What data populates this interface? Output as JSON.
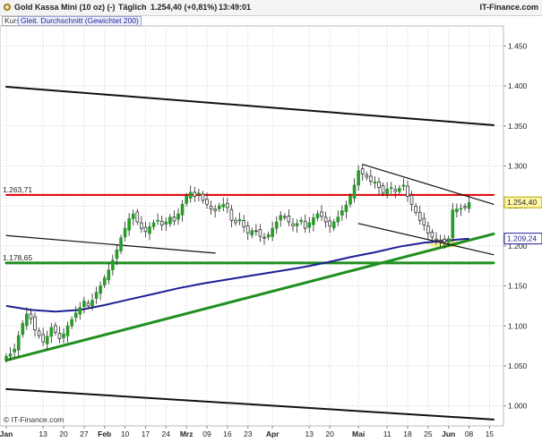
{
  "header": {
    "instrument": "Gold Kassa Mini (10 oz) (-)",
    "interval": "Täglich",
    "quote": "1.254,40 (+0,81%)",
    "time": "13:49:01",
    "brand": "IT-Finance.com"
  },
  "legend": {
    "price_tag": "Kurs",
    "ma_tag": "Gleit. Durchschnitt (Gewichtet 200)"
  },
  "watermark": "© IT-Finance.com",
  "colors": {
    "up": "#2a9a2a",
    "down": "#8a2020",
    "ma": "#1e1e96",
    "resistance": "#e00000",
    "support": "#1f8f1f",
    "trendline": "#111111",
    "current_tag": "#1e1e96"
  },
  "chart_data": {
    "type": "candlestick",
    "y_axis": {
      "min": 0.975,
      "max": 1.475,
      "ticks": [
        1.0,
        1.05,
        1.1,
        1.15,
        1.2,
        1.25,
        1.3,
        1.35,
        1.4,
        1.45
      ],
      "tick_labels": [
        "1.000",
        "1.050",
        "1.100",
        "1.150",
        "1.200",
        "1.250",
        "1.300",
        "1.350",
        "1.400",
        "1.450"
      ]
    },
    "x_axis": {
      "labels": [
        {
          "day": 0,
          "text": "Jan",
          "month": true
        },
        {
          "day": 9,
          "text": "13"
        },
        {
          "day": 14,
          "text": "20"
        },
        {
          "day": 19,
          "text": "27"
        },
        {
          "day": 24,
          "text": "Feb",
          "month": true
        },
        {
          "day": 29,
          "text": "10"
        },
        {
          "day": 34,
          "text": "17"
        },
        {
          "day": 39,
          "text": "24"
        },
        {
          "day": 44,
          "text": "Mrz",
          "month": true
        },
        {
          "day": 49,
          "text": "09"
        },
        {
          "day": 54,
          "text": "16"
        },
        {
          "day": 59,
          "text": "23"
        },
        {
          "day": 65,
          "text": "Apr",
          "month": true
        },
        {
          "day": 74,
          "text": "13"
        },
        {
          "day": 79,
          "text": "20"
        },
        {
          "day": 86,
          "text": "Mai",
          "month": true
        },
        {
          "day": 93,
          "text": "11"
        },
        {
          "day": 98,
          "text": "18"
        },
        {
          "day": 103,
          "text": "25"
        },
        {
          "day": 108,
          "text": "Jun",
          "month": true
        },
        {
          "day": 113,
          "text": "08"
        },
        {
          "day": 118,
          "text": "15"
        }
      ],
      "last_day": 119
    },
    "price_markers": [
      {
        "label": "1.263,71",
        "value": 1.2637,
        "color": "#e00000"
      },
      {
        "label": "1.178,65",
        "value": 1.1787,
        "color": "#1f8f1f"
      }
    ],
    "current_price": {
      "label": "1.254,40",
      "value": 1.2544
    },
    "ma_current": {
      "label": "1.209,24",
      "value": 1.2092
    },
    "close": [
      1.062,
      1.065,
      1.071,
      1.088,
      1.103,
      1.115,
      1.109,
      1.095,
      1.088,
      1.08,
      1.087,
      1.098,
      1.092,
      1.084,
      1.09,
      1.1,
      1.108,
      1.116,
      1.123,
      1.131,
      1.125,
      1.132,
      1.142,
      1.15,
      1.16,
      1.17,
      1.182,
      1.195,
      1.21,
      1.222,
      1.234,
      1.24,
      1.23,
      1.222,
      1.218,
      1.224,
      1.229,
      1.232,
      1.226,
      1.23,
      1.236,
      1.231,
      1.24,
      1.252,
      1.262,
      1.267,
      1.262,
      1.266,
      1.257,
      1.252,
      1.246,
      1.244,
      1.25,
      1.252,
      1.248,
      1.232,
      1.229,
      1.233,
      1.224,
      1.216,
      1.219,
      1.218,
      1.212,
      1.21,
      1.214,
      1.222,
      1.23,
      1.238,
      1.236,
      1.23,
      1.225,
      1.228,
      1.232,
      1.222,
      1.229,
      1.235,
      1.24,
      1.237,
      1.23,
      1.225,
      1.23,
      1.236,
      1.244,
      1.251,
      1.262,
      1.276,
      1.294,
      1.29,
      1.286,
      1.281,
      1.28,
      1.273,
      1.266,
      1.271,
      1.273,
      1.268,
      1.272,
      1.276,
      1.262,
      1.252,
      1.242,
      1.232,
      1.226,
      1.216,
      1.211,
      1.207,
      1.206,
      1.205,
      1.209,
      1.245,
      1.246,
      1.247,
      1.248,
      1.254
    ],
    "ma200": [
      [
        0,
        1.125
      ],
      [
        6,
        1.12
      ],
      [
        12,
        1.118
      ],
      [
        18,
        1.12
      ],
      [
        24,
        1.126
      ],
      [
        30,
        1.133
      ],
      [
        36,
        1.14
      ],
      [
        42,
        1.147
      ],
      [
        48,
        1.153
      ],
      [
        54,
        1.158
      ],
      [
        60,
        1.163
      ],
      [
        66,
        1.168
      ],
      [
        72,
        1.173
      ],
      [
        78,
        1.179
      ],
      [
        84,
        1.186
      ],
      [
        90,
        1.192
      ],
      [
        96,
        1.199
      ],
      [
        102,
        1.204
      ],
      [
        108,
        1.207
      ],
      [
        113,
        1.209
      ]
    ],
    "lines": [
      {
        "name": "resistance-line",
        "color": "#e00000",
        "width": 2,
        "from": [
          0,
          1.2637
        ],
        "to": [
          119,
          1.2637
        ]
      },
      {
        "name": "support-line",
        "color": "#1f8f1f",
        "width": 3,
        "from": [
          0,
          1.1787
        ],
        "to": [
          119,
          1.1787
        ]
      },
      {
        "name": "long-uptrend-line",
        "color": "#1f8f1f",
        "width": 3,
        "from": [
          0,
          1.057
        ],
        "to": [
          119,
          1.215
        ]
      },
      {
        "name": "upper-channel-line",
        "color": "#111111",
        "width": 2,
        "from": [
          0,
          1.399
        ],
        "to": [
          119,
          1.351
        ]
      },
      {
        "name": "lower-channel-line",
        "color": "#111111",
        "width": 2,
        "from": [
          0,
          1.021
        ],
        "to": [
          119,
          0.983
        ]
      },
      {
        "name": "feb-resistance-line",
        "color": "#111111",
        "width": 1.2,
        "from": [
          0,
          1.213
        ],
        "to": [
          51,
          1.191
        ]
      },
      {
        "name": "may-upper-wedge-line",
        "color": "#111111",
        "width": 1.2,
        "from": [
          87,
          1.302
        ],
        "to": [
          119,
          1.252
        ]
      },
      {
        "name": "may-lower-wedge-line",
        "color": "#111111",
        "width": 1.2,
        "from": [
          86,
          1.228
        ],
        "to": [
          119,
          1.189
        ]
      }
    ],
    "highlight": {
      "from_day": 104,
      "to_day": 110,
      "center": 1.203,
      "color": "#f4f08a"
    }
  }
}
